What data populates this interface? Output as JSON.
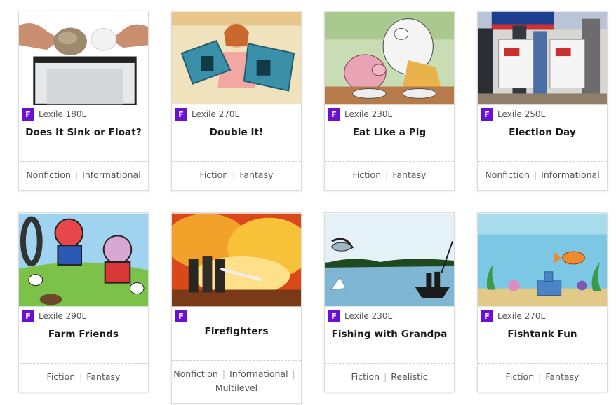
{
  "badge": {
    "letter": "F",
    "color": "#6b0fd1"
  },
  "books": [
    {
      "title": "Does It Sink or Float?",
      "lexile": "Lexile 180L",
      "categories": [
        "Nonfiction",
        "Informational"
      ],
      "image_icon": "rock-and-paper-photo-icon"
    },
    {
      "title": "Double It!",
      "lexile": "Lexile 270L",
      "categories": [
        "Fiction",
        "Fantasy"
      ],
      "image_icon": "girl-with-boxes-illustration-icon"
    },
    {
      "title": "Eat Like a Pig",
      "lexile": "Lexile 230L",
      "categories": [
        "Fiction",
        "Fantasy"
      ],
      "image_icon": "pig-and-poodle-illustration-icon"
    },
    {
      "title": "Election Day",
      "lexile": "Lexile 250L",
      "categories": [
        "Nonfiction",
        "Informational"
      ],
      "image_icon": "voting-booths-photo-icon"
    },
    {
      "title": "Farm Friends",
      "lexile": "Lexile 290L",
      "categories": [
        "Fiction",
        "Fantasy"
      ],
      "image_icon": "farm-animals-cartoon-icon"
    },
    {
      "title": "Firefighters",
      "lexile": "",
      "categories": [
        "Nonfiction",
        "Informational",
        "Multilevel"
      ],
      "image_icon": "firefighters-photo-icon"
    },
    {
      "title": "Fishing with Grandpa",
      "lexile": "Lexile 230L",
      "categories": [
        "Fiction",
        "Realistic"
      ],
      "image_icon": "fishing-boat-illustration-icon"
    },
    {
      "title": "Fishtank Fun",
      "lexile": "Lexile 270L",
      "categories": [
        "Fiction",
        "Fantasy"
      ],
      "image_icon": "fishtank-illustration-icon"
    }
  ]
}
